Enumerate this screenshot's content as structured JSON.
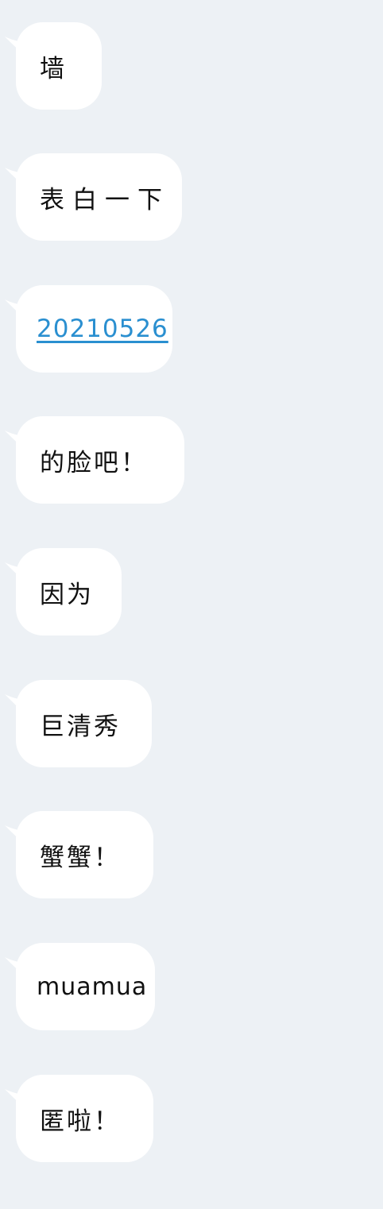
{
  "messages": [
    {
      "text": "墙",
      "type": "text"
    },
    {
      "text": "表白一下",
      "type": "text"
    },
    {
      "text": "20210526",
      "type": "link"
    },
    {
      "text": "的脸吧！",
      "type": "text"
    },
    {
      "text": "因为",
      "type": "text"
    },
    {
      "text": "巨清秀",
      "type": "text"
    },
    {
      "text": "蟹蟹！",
      "type": "text"
    },
    {
      "text": "muamua",
      "type": "text"
    },
    {
      "text": "匿啦！",
      "type": "text"
    }
  ],
  "colors": {
    "background": "#edf1f5",
    "bubble": "#ffffff",
    "text": "#111111",
    "link": "#2a8fd0"
  }
}
